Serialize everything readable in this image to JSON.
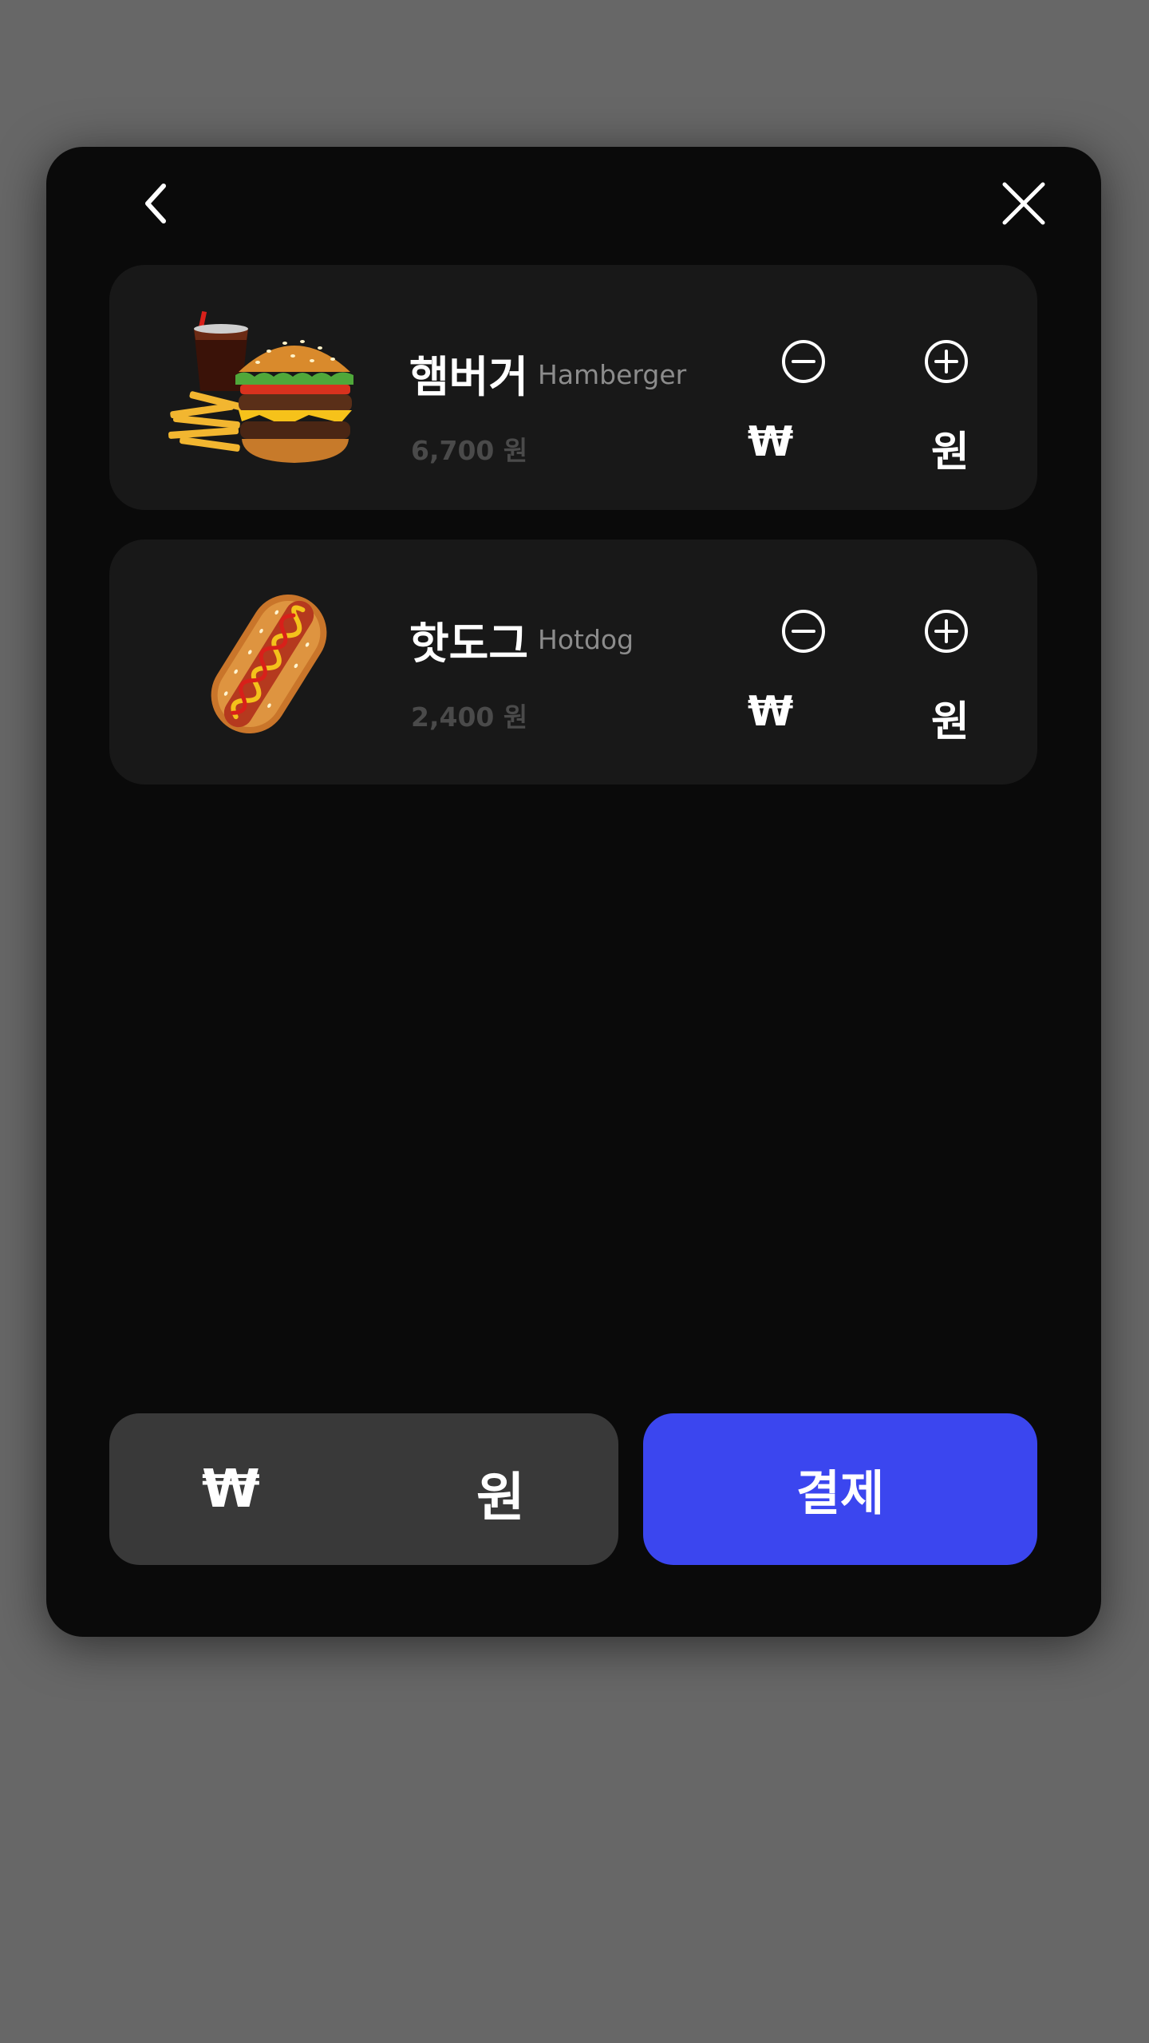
{
  "cart": {
    "items": [
      {
        "name_ko": "햄버거",
        "name_en": "Hamberger",
        "price": "6,700 원",
        "amount_symbol": "₩",
        "amount_unit": "원",
        "image": "burger-combo-icon"
      },
      {
        "name_ko": "핫도그",
        "name_en": "Hotdog",
        "price": "2,400 원",
        "amount_symbol": "₩",
        "amount_unit": "원",
        "image": "hotdog-icon"
      }
    ]
  },
  "footer": {
    "total_symbol": "₩",
    "total_unit": "원",
    "pay_label": "결제"
  },
  "colors": {
    "backdrop": "#676767",
    "modal": "#0a0a0a",
    "card": "#181818",
    "total_box": "#393939",
    "accent": "#3b46ef"
  }
}
